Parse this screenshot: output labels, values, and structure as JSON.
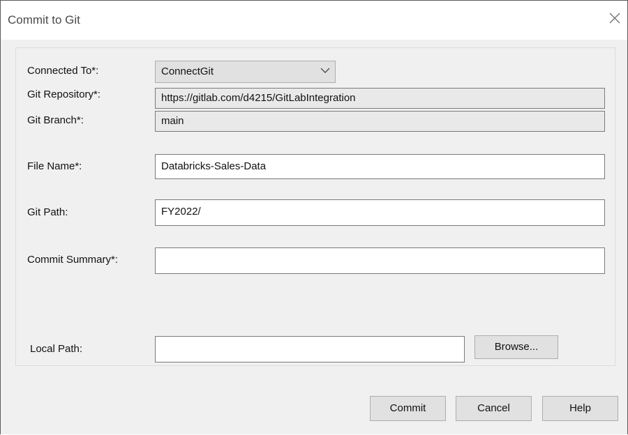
{
  "dialog": {
    "title": "Commit to Git",
    "close_icon": "close-icon"
  },
  "form": {
    "connected_to": {
      "label": "Connected To*:",
      "value": "ConnectGit",
      "icon": "chevron-down-icon"
    },
    "git_repository": {
      "label": "Git Repository*:",
      "value": "https://gitlab.com/d4215/GitLabIntegration"
    },
    "git_branch": {
      "label": "Git Branch*:",
      "value": "main"
    },
    "file_name": {
      "label": "File Name*:",
      "value": "Databricks-Sales-Data"
    },
    "git_path": {
      "label": "Git Path:",
      "value": "FY2022/"
    },
    "commit_summary": {
      "label": "Commit Summary*:",
      "value": ""
    },
    "local_path": {
      "label": "Local Path:",
      "value": "",
      "browse_label": "Browse..."
    }
  },
  "footer": {
    "commit_label": "Commit",
    "cancel_label": "Cancel",
    "help_label": "Help"
  }
}
